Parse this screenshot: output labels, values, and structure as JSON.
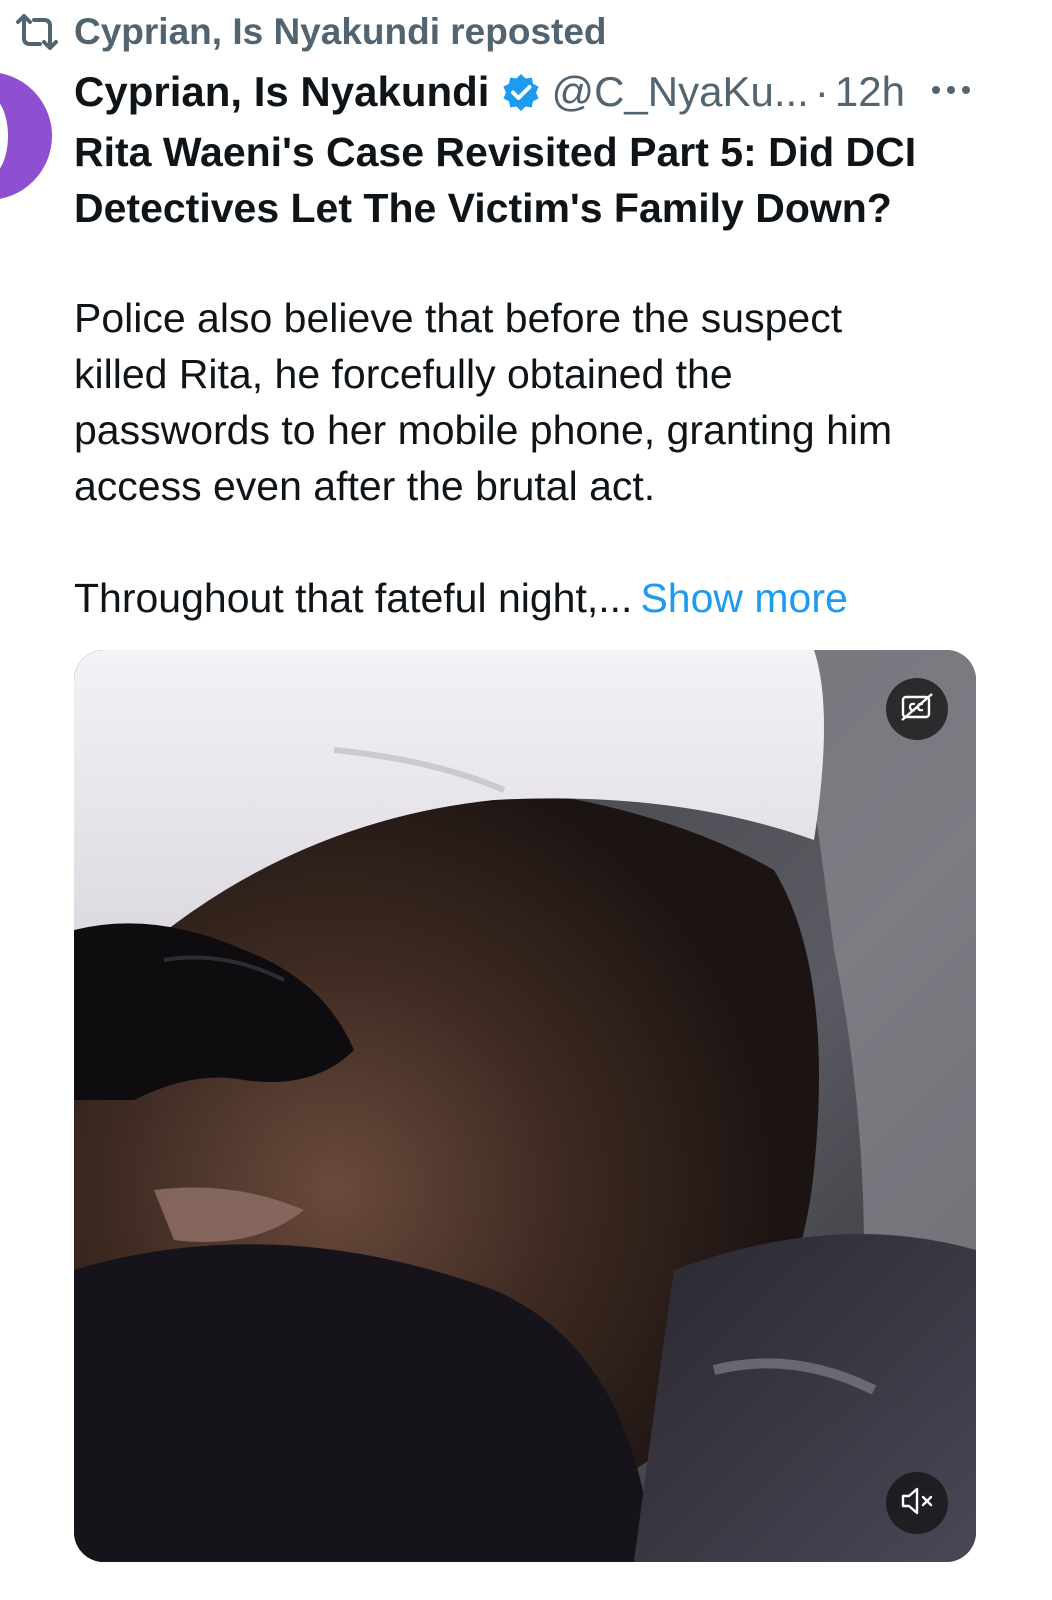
{
  "repost": {
    "text": "Cyprian, Is Nyakundi reposted",
    "icon": "repost-icon"
  },
  "tweet": {
    "author_name": "Cyprian, Is Nyakundi",
    "verified_icon": "verified-badge-icon",
    "handle": "@C_NyaKu...",
    "separator": "·",
    "time": "12h",
    "title_line_1": "Rita Waeni's Case Revisited Part 5: Did DCI",
    "title_line_2": "Detectives Let The Victim's Family Down?",
    "body_lines": [
      "Police also believe that before the suspect",
      "killed Rita, he forcefully obtained the",
      "passwords to her mobile phone, granting him",
      "access even after the brutal act."
    ],
    "excerpt": "Throughout that fateful night,...",
    "show_more": "Show more"
  },
  "media": {
    "type": "video",
    "cc_icon": "captions-off-icon",
    "mute_icon": "muted-speaker-icon"
  },
  "colors": {
    "text_primary": "#0f1419",
    "text_secondary": "#536471",
    "link": "#1d9bf0",
    "verified": "#1d9bf0",
    "avatar": "#8e4fd0"
  }
}
